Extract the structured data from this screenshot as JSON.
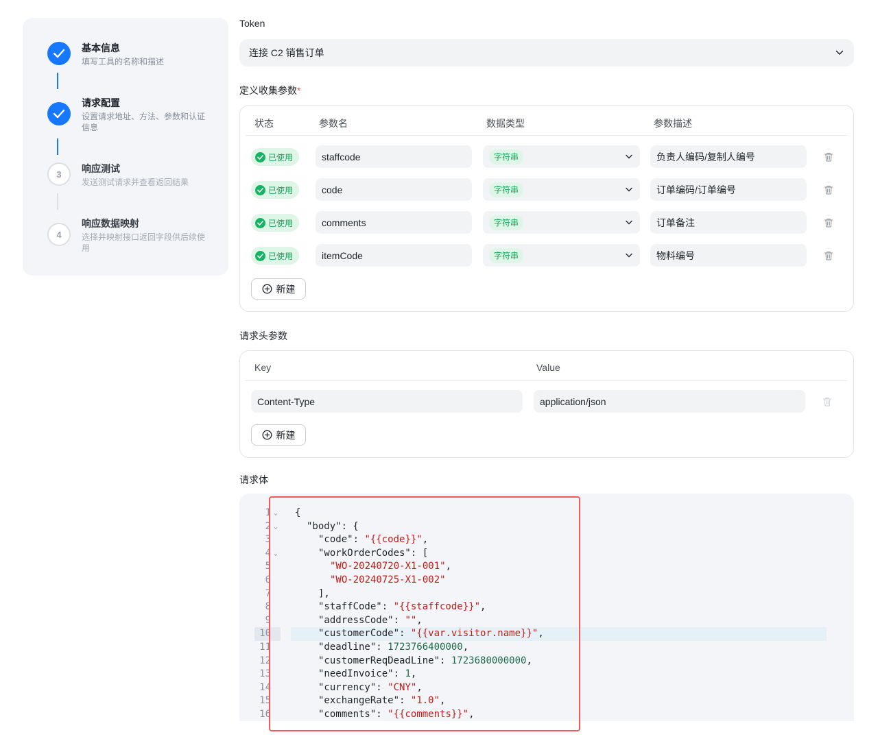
{
  "steps": [
    {
      "title": "基本信息",
      "desc": "填写工具的名称和描述",
      "state": "done"
    },
    {
      "title": "请求配置",
      "desc": "设置请求地址、方法、参数和认证信息",
      "state": "done"
    },
    {
      "title": "响应测试",
      "desc": "发送测试请求并查看返回结果",
      "state": "todo",
      "num": "3"
    },
    {
      "title": "响应数据映射",
      "desc": "选择并映射接口返回字段供后续使用",
      "state": "todo",
      "num": "4"
    }
  ],
  "token": {
    "label": "Token",
    "value": "连接 C2 销售订单",
    "icon": "chevron-down-icon"
  },
  "params": {
    "label": "定义收集参数",
    "required_mark": "*",
    "headers": {
      "status": "状态",
      "name": "参数名",
      "type": "数据类型",
      "desc": "参数描述"
    },
    "rows": [
      {
        "status": "已使用",
        "name": "staffcode",
        "type": "字符串",
        "desc": "负责人编码/复制人编号"
      },
      {
        "status": "已使用",
        "name": "code",
        "type": "字符串",
        "desc": "订单编码/订单编号"
      },
      {
        "status": "已使用",
        "name": "comments",
        "type": "字符串",
        "desc": "订单备注"
      },
      {
        "status": "已使用",
        "name": "itemCode",
        "type": "字符串",
        "desc": "物料编号"
      }
    ],
    "new_label": "新建"
  },
  "headers_section": {
    "label": "请求头参数",
    "headers": {
      "key": "Key",
      "value": "Value"
    },
    "rows": [
      {
        "key": "Content-Type",
        "value": "application/json"
      }
    ],
    "new_label": "新建"
  },
  "body_section": {
    "label": "请求体",
    "active_line": 10,
    "lines": [
      {
        "n": "1",
        "fold": true,
        "indent": 0,
        "tokens": [
          {
            "t": "punc",
            "v": "{"
          }
        ]
      },
      {
        "n": "2",
        "fold": true,
        "indent": 1,
        "tokens": [
          {
            "t": "key",
            "v": "\"body\""
          },
          {
            "t": "punc",
            "v": ": {"
          }
        ]
      },
      {
        "n": "3",
        "fold": false,
        "indent": 2,
        "tokens": [
          {
            "t": "key",
            "v": "\"code\""
          },
          {
            "t": "punc",
            "v": ": "
          },
          {
            "t": "str",
            "v": "\"{{code}}\""
          },
          {
            "t": "punc",
            "v": ","
          }
        ]
      },
      {
        "n": "4",
        "fold": true,
        "indent": 2,
        "tokens": [
          {
            "t": "key",
            "v": "\"workOrderCodes\""
          },
          {
            "t": "punc",
            "v": ": ["
          }
        ]
      },
      {
        "n": "5",
        "fold": false,
        "indent": 3,
        "tokens": [
          {
            "t": "str",
            "v": "\"WO-20240720-X1-001\""
          },
          {
            "t": "punc",
            "v": ","
          }
        ]
      },
      {
        "n": "6",
        "fold": false,
        "indent": 3,
        "tokens": [
          {
            "t": "str",
            "v": "\"WO-20240725-X1-002\""
          }
        ]
      },
      {
        "n": "7",
        "fold": false,
        "indent": 2,
        "tokens": [
          {
            "t": "punc",
            "v": "],"
          }
        ]
      },
      {
        "n": "8",
        "fold": false,
        "indent": 2,
        "tokens": [
          {
            "t": "key",
            "v": "\"staffCode\""
          },
          {
            "t": "punc",
            "v": ": "
          },
          {
            "t": "str",
            "v": "\"{{staffcode}}\""
          },
          {
            "t": "punc",
            "v": ","
          }
        ]
      },
      {
        "n": "9",
        "fold": false,
        "indent": 2,
        "tokens": [
          {
            "t": "key",
            "v": "\"addressCode\""
          },
          {
            "t": "punc",
            "v": ": "
          },
          {
            "t": "str",
            "v": "\"\""
          },
          {
            "t": "punc",
            "v": ","
          }
        ]
      },
      {
        "n": "10",
        "fold": false,
        "indent": 2,
        "tokens": [
          {
            "t": "key",
            "v": "\"customerCode\""
          },
          {
            "t": "punc",
            "v": ": "
          },
          {
            "t": "str",
            "v": "\"{{var.visitor.name}}\""
          },
          {
            "t": "punc",
            "v": ","
          }
        ]
      },
      {
        "n": "11",
        "fold": false,
        "indent": 2,
        "tokens": [
          {
            "t": "key",
            "v": "\"deadline\""
          },
          {
            "t": "punc",
            "v": ": "
          },
          {
            "t": "num",
            "v": "1723766400000"
          },
          {
            "t": "punc",
            "v": ","
          }
        ]
      },
      {
        "n": "12",
        "fold": false,
        "indent": 2,
        "tokens": [
          {
            "t": "key",
            "v": "\"customerReqDeadLine\""
          },
          {
            "t": "punc",
            "v": ": "
          },
          {
            "t": "num",
            "v": "1723680000000"
          },
          {
            "t": "punc",
            "v": ","
          }
        ]
      },
      {
        "n": "13",
        "fold": false,
        "indent": 2,
        "tokens": [
          {
            "t": "key",
            "v": "\"needInvoice\""
          },
          {
            "t": "punc",
            "v": ": "
          },
          {
            "t": "num",
            "v": "1"
          },
          {
            "t": "punc",
            "v": ","
          }
        ]
      },
      {
        "n": "14",
        "fold": false,
        "indent": 2,
        "tokens": [
          {
            "t": "key",
            "v": "\"currency\""
          },
          {
            "t": "punc",
            "v": ": "
          },
          {
            "t": "str",
            "v": "\"CNY\""
          },
          {
            "t": "punc",
            "v": ","
          }
        ]
      },
      {
        "n": "15",
        "fold": false,
        "indent": 2,
        "tokens": [
          {
            "t": "key",
            "v": "\"exchangeRate\""
          },
          {
            "t": "punc",
            "v": ": "
          },
          {
            "t": "str",
            "v": "\"1.0\""
          },
          {
            "t": "punc",
            "v": ","
          }
        ]
      },
      {
        "n": "16",
        "fold": false,
        "indent": 2,
        "tokens": [
          {
            "t": "key",
            "v": "\"comments\""
          },
          {
            "t": "punc",
            "v": ": "
          },
          {
            "t": "str",
            "v": "\"{{comments}}\""
          },
          {
            "t": "punc",
            "v": ","
          }
        ]
      }
    ]
  },
  "colors": {
    "accent": "#1677ff",
    "success": "#16b364",
    "string": "#c41a16",
    "number": "#1c6b48",
    "highlight_border": "#f5575b"
  }
}
